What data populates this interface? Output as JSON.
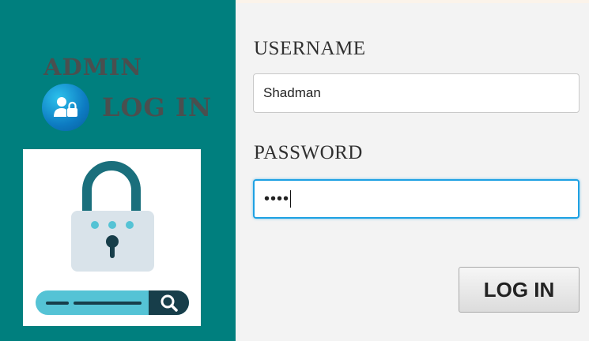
{
  "sidebar": {
    "brand_title": "ADMIN",
    "brand_login": "LOG IN",
    "icon": "user-lock-icon",
    "illustration": "padlock-search-illustration"
  },
  "form": {
    "username_label": "USERNAME",
    "username_value": "Shadman",
    "password_label": "PASSWORD",
    "password_value": "••••",
    "login_button": "LOG IN"
  },
  "colors": {
    "sidebar_bg": "#007f7e",
    "main_bg": "#f3f3f3",
    "focus_border": "#1ea1e3",
    "icon_blue": "#0d7bc2",
    "lock_shackle": "#1a6f7c",
    "search_bar": "#55c3d5"
  }
}
